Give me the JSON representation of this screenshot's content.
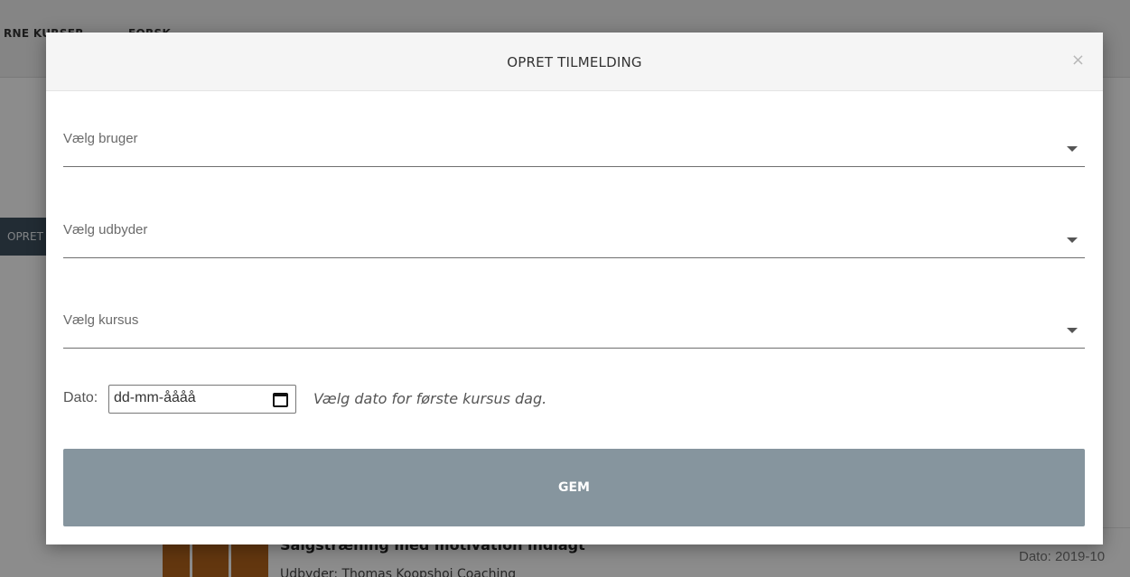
{
  "background": {
    "nav_items": [
      "RNE KURSER",
      "FORSK"
    ],
    "create_button_label": "OPRET",
    "card": {
      "title": "Salgstræning med motivation indlagt",
      "subtitle": "Udbyder: Thomas Koopshoi Coaching",
      "date": "Dato: 2019-10"
    }
  },
  "modal": {
    "title": "OPRET TILMELDING",
    "close_glyph": "×",
    "fields": {
      "user_label": "Vælg bruger",
      "provider_label": "Vælg udbyder",
      "course_label": "Vælg kursus"
    },
    "date": {
      "label": "Dato:",
      "placeholder": "dd-mm-åååå",
      "hint": "Vælg dato for første kursus dag."
    },
    "save_label": "GEM"
  },
  "colors": {
    "save_button": "#86959e",
    "create_button": "#3f5160",
    "header_bg": "#f5f5f5"
  },
  "icons": {
    "close": "close-icon",
    "caret": "chevron-down-icon",
    "calendar": "calendar-icon"
  }
}
